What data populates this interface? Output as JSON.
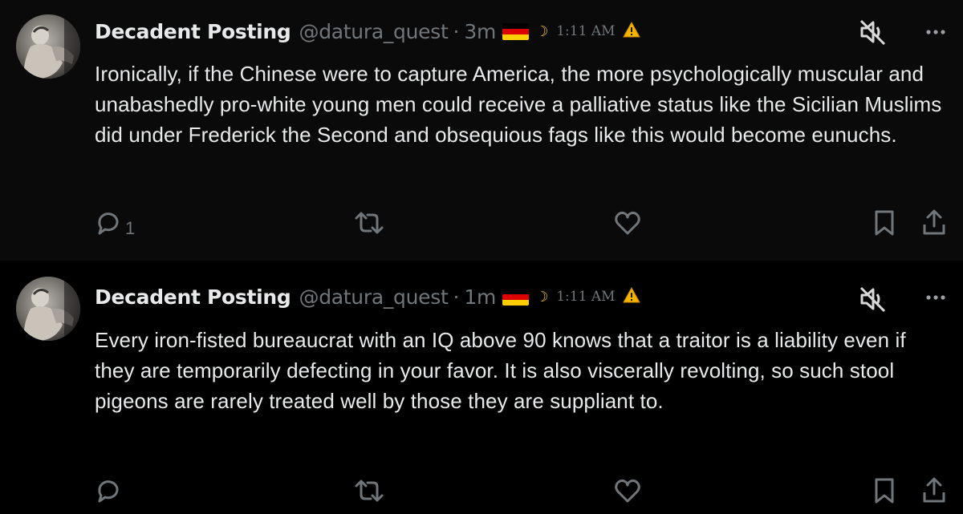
{
  "posts": [
    {
      "author": {
        "display_name": "Decadent Posting",
        "handle": "@datura_quest",
        "avatar_icon": "classical-statue-avatar"
      },
      "separator": "·",
      "time_ago": "3m",
      "flag_icon": "germany-flag-icon",
      "moon_glyph": "☽",
      "clock_text": "1:11 AM",
      "warning_icon": "warning-icon",
      "body": "Ironically, if the Chinese were to capture America, the more psychologically muscular and unabashedly pro-white young men could receive a palliative status like the Sicilian Muslims did under Frederick the Second and obsequious fags like this would become eunuchs.",
      "reply_count": "1",
      "retweet_count": "",
      "like_count": ""
    },
    {
      "author": {
        "display_name": "Decadent Posting",
        "handle": "@datura_quest",
        "avatar_icon": "classical-statue-avatar"
      },
      "separator": "·",
      "time_ago": "1m",
      "flag_icon": "germany-flag-icon",
      "moon_glyph": "☽",
      "clock_text": "1:11 AM",
      "warning_icon": "warning-icon",
      "body": "Every iron-fisted bureaucrat with an IQ above 90 knows that a traitor is a liability even if they are temporarily defecting in your favor. It is also viscerally revolting, so such stool pigeons are rarely treated well by those they are suppliant to.",
      "reply_count": "",
      "retweet_count": "",
      "like_count": ""
    }
  ],
  "colors": {
    "background": "#000000",
    "highlighted_post_bg": "#0a0a0a",
    "primary_text": "#e7e9ea",
    "secondary_text": "#71767b",
    "thread_line": "#3a3d42",
    "warning": "#f4b400"
  },
  "icons": [
    "mute-icon",
    "more-icon",
    "reply-icon",
    "retweet-icon",
    "like-icon",
    "bookmark-icon",
    "share-icon"
  ]
}
